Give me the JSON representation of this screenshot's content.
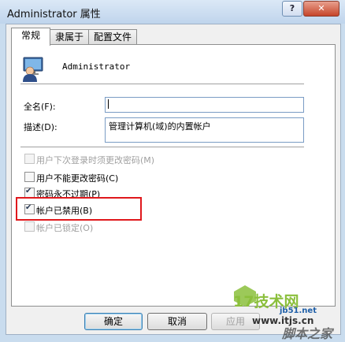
{
  "window": {
    "title": "Administrator 属性",
    "help_label": "?",
    "close_label": "✕"
  },
  "tabs": [
    {
      "label": "常规",
      "active": true
    },
    {
      "label": "隶属于",
      "active": false
    },
    {
      "label": "配置文件",
      "active": false
    }
  ],
  "user": {
    "name": "Administrator",
    "avatar_icon": "user-account-icon"
  },
  "fields": {
    "fullname_label": "全名(F):",
    "fullname_value": "",
    "description_label": "描述(D):",
    "description_value": "管理计算机(域)的内置帐户"
  },
  "options": [
    {
      "label": "用户下次登录时须更改密码(M)",
      "checked": false,
      "disabled": true
    },
    {
      "label": "用户不能更改密码(C)",
      "checked": false,
      "disabled": false
    },
    {
      "label": "密码永不过期(P)",
      "checked": true,
      "disabled": false
    },
    {
      "label": "帐户已禁用(B)",
      "checked": true,
      "disabled": false,
      "highlighted": true
    },
    {
      "label": "帐户已锁定(O)",
      "checked": false,
      "disabled": true
    }
  ],
  "buttons": {
    "ok": "确定",
    "cancel": "取消",
    "apply": "应用"
  },
  "watermark": {
    "logo_text": "17技术网",
    "url": "www.itjs.cn",
    "brand": "脚本之家",
    "site": "jb51.net"
  },
  "colors": {
    "highlight_box": "#e0181c",
    "watermark_green": "#8bbf3c"
  }
}
